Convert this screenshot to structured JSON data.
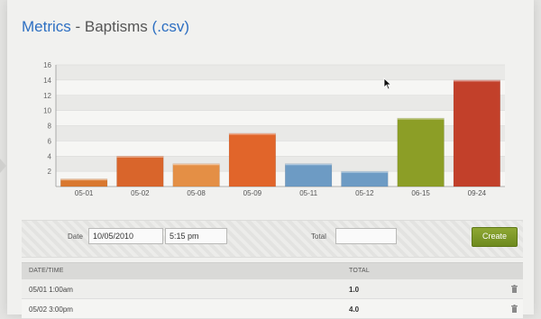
{
  "header": {
    "title_prefix": "Metrics",
    "title_separator": " - ",
    "title_name": "Baptisms",
    "title_csv": "(.csv)"
  },
  "chart_data": {
    "type": "bar",
    "categories": [
      "05-01",
      "05-02",
      "05-08",
      "05-09",
      "05-11",
      "05-12",
      "06-15",
      "09-24"
    ],
    "values": [
      1,
      4,
      3,
      7,
      3,
      2,
      9,
      14
    ],
    "colors": [
      "#d9782f",
      "#d9652b",
      "#e48f45",
      "#e1652a",
      "#6d9bc4",
      "#6d9bc4",
      "#8c9e26",
      "#c2402a"
    ],
    "y_ticks": [
      2,
      4,
      6,
      8,
      10,
      12,
      14,
      16
    ],
    "ylim": [
      0,
      16
    ],
    "grid": true
  },
  "form": {
    "date_label": "Date",
    "date_value": "10/05/2010",
    "time_value": "5:15 pm",
    "total_label": "Total",
    "total_value": "",
    "create_label": "Create"
  },
  "table": {
    "headers": {
      "datetime": "DATE/TIME",
      "total": "TOTAL"
    },
    "rows": [
      {
        "datetime": "05/01 1:00am",
        "total": "1.0"
      },
      {
        "datetime": "05/02 3:00pm",
        "total": "4.0"
      }
    ]
  },
  "icons": {
    "delete": "trash-icon",
    "pointer": "mouse-cursor-icon"
  }
}
